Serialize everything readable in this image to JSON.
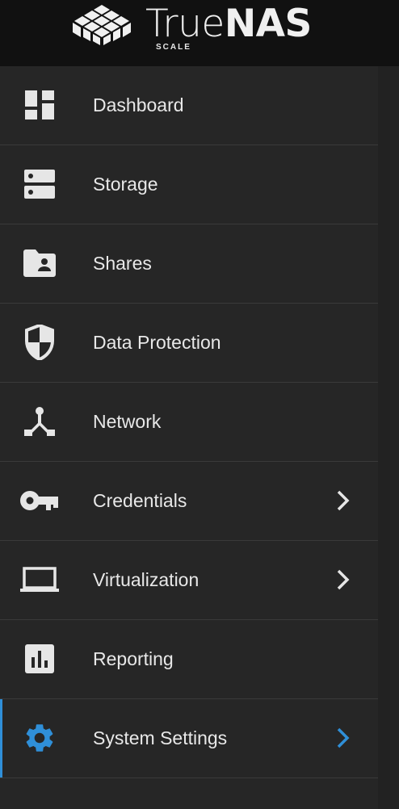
{
  "brand": {
    "name_light": "True",
    "name_bold": "NAS",
    "edition": "SCALE"
  },
  "colors": {
    "header_bg": "#111111",
    "nav_bg": "#262626",
    "accent": "#2f8fd8",
    "text": "#e8e8e8",
    "divider": "#3a3a3a"
  },
  "nav": {
    "items": [
      {
        "label": "Dashboard",
        "icon": "dashboard-icon",
        "has_submenu": false,
        "active": false
      },
      {
        "label": "Storage",
        "icon": "storage-icon",
        "has_submenu": false,
        "active": false
      },
      {
        "label": "Shares",
        "icon": "shares-folder-icon",
        "has_submenu": false,
        "active": false
      },
      {
        "label": "Data Protection",
        "icon": "shield-icon",
        "has_submenu": false,
        "active": false
      },
      {
        "label": "Network",
        "icon": "network-icon",
        "has_submenu": false,
        "active": false
      },
      {
        "label": "Credentials",
        "icon": "key-icon",
        "has_submenu": true,
        "active": false
      },
      {
        "label": "Virtualization",
        "icon": "laptop-icon",
        "has_submenu": true,
        "active": false
      },
      {
        "label": "Reporting",
        "icon": "bar-chart-icon",
        "has_submenu": false,
        "active": false
      },
      {
        "label": "System Settings",
        "icon": "gear-icon",
        "has_submenu": true,
        "active": true
      }
    ]
  }
}
